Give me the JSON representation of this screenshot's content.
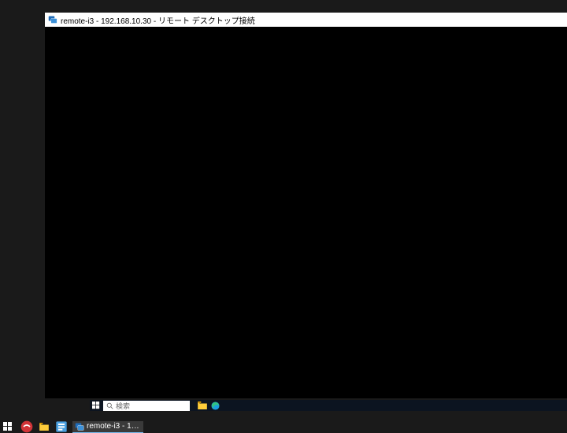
{
  "rdp": {
    "title": "remote-i3 - 192.168.10.30 - リモート デスクトップ接続"
  },
  "remote_taskbar": {
    "search_placeholder": "検索"
  },
  "host_taskbar": {
    "item_label": "remote-i3 - 192.168.1…"
  }
}
